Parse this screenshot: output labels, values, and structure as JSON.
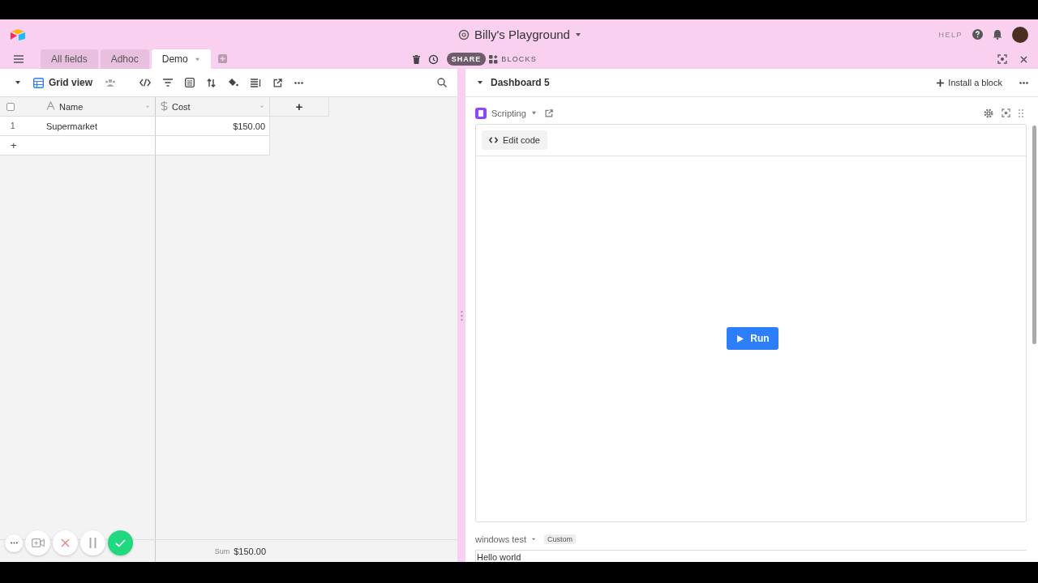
{
  "app": {
    "title": "Billy's Playground",
    "help": "HELP"
  },
  "select_all": {
    "checked": false
  },
  "tabs": [
    {
      "label": "All fields",
      "selected": false
    },
    {
      "label": "Adhoc",
      "selected": false
    },
    {
      "label": "Demo",
      "selected": true
    }
  ],
  "toolbar": {
    "share": "SHARE",
    "blocks": "BLOCKS"
  },
  "grid": {
    "view": "Grid view",
    "columns": [
      {
        "name": "Name",
        "kind": "text"
      },
      {
        "name": "Cost",
        "kind": "currency"
      }
    ],
    "rows": [
      {
        "number": "1",
        "cells": [
          "Supermarket",
          "$150.00"
        ]
      }
    ],
    "add_row": "+",
    "add_column": "+",
    "summary": {
      "label": "Sum",
      "value": "$150.00"
    }
  },
  "dashboard": {
    "title": "Dashboard 5",
    "install": "Install a block",
    "block": {
      "name": "Scripting",
      "edit": "Edit code",
      "run": "Run"
    },
    "second_block": {
      "name": "windows test",
      "badge": "Custom",
      "output": "Hello world"
    }
  }
}
